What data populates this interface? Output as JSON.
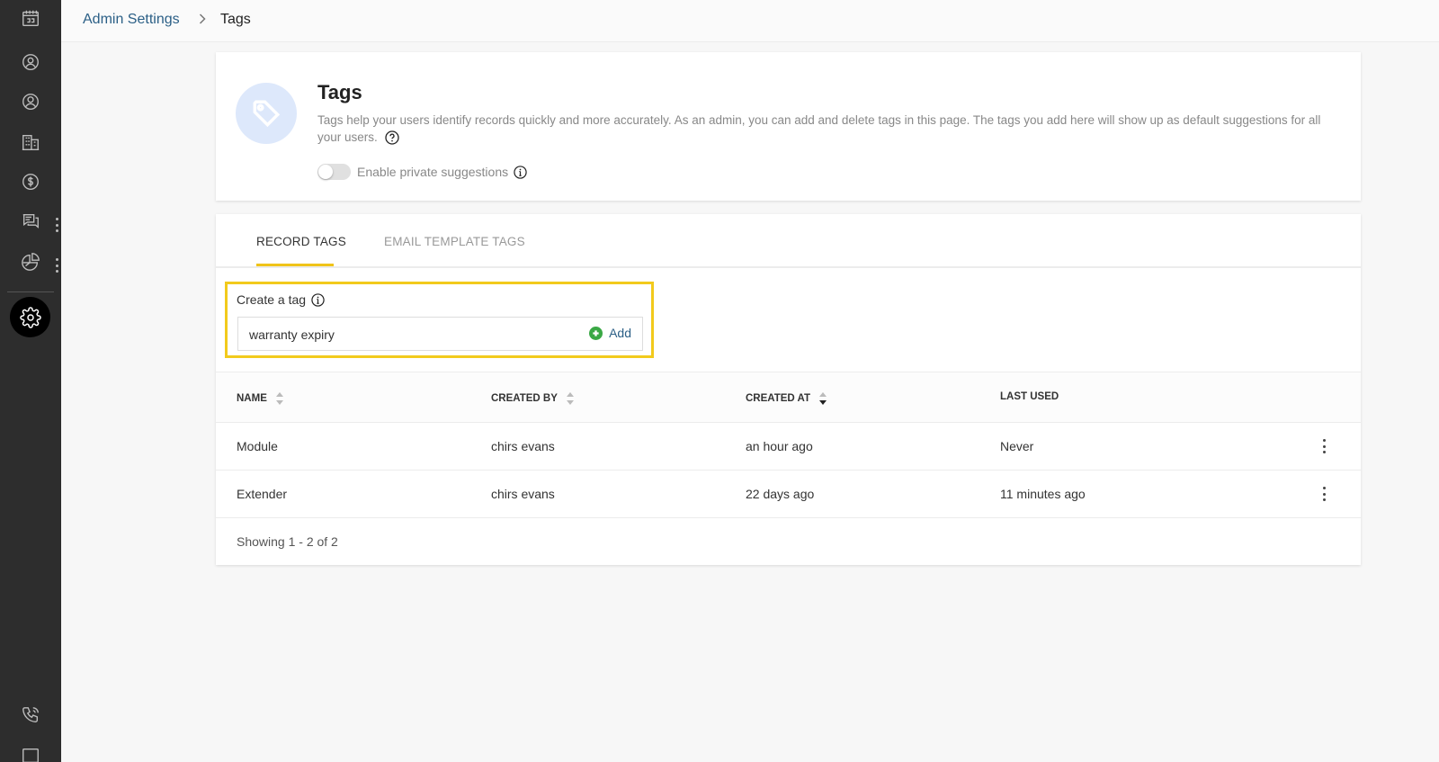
{
  "breadcrumb": {
    "parent": "Admin Settings",
    "current": "Tags"
  },
  "sidebar": {
    "icons": [
      "calendar-icon",
      "contact-icon",
      "user-icon",
      "building-icon",
      "dollar-icon",
      "chat-icon",
      "chart-icon",
      "settings-icon",
      "phone-icon",
      "window-icon"
    ],
    "active": "settings-icon"
  },
  "header": {
    "title": "Tags",
    "description": "Tags help your users identify records quickly and more accurately. As an admin, you can add and delete tags in this page. The tags you add here will show up as default suggestions for all your users.",
    "toggle_label": "Enable private suggestions",
    "toggle_on": false
  },
  "tabs": [
    {
      "label": "RECORD TAGS",
      "active": true
    },
    {
      "label": "EMAIL TEMPLATE TAGS",
      "active": false
    }
  ],
  "create_tag": {
    "label": "Create a tag",
    "input_value": "warranty expiry",
    "add_label": "Add"
  },
  "table": {
    "columns": [
      "NAME",
      "CREATED BY",
      "CREATED AT",
      "LAST USED"
    ],
    "rows": [
      {
        "name": "Module",
        "created_by": "chirs evans",
        "created_at": "an hour ago",
        "last_used": "Never"
      },
      {
        "name": "Extender",
        "created_by": "chirs evans",
        "created_at": "22 days ago",
        "last_used": "11 minutes ago"
      }
    ],
    "footer": "Showing 1 - 2 of 2"
  },
  "colors": {
    "sidebar_bg": "#2d2d2d",
    "accent_yellow": "#f2ca1c",
    "link_blue": "#2b5f86",
    "add_green": "#3aa845"
  }
}
